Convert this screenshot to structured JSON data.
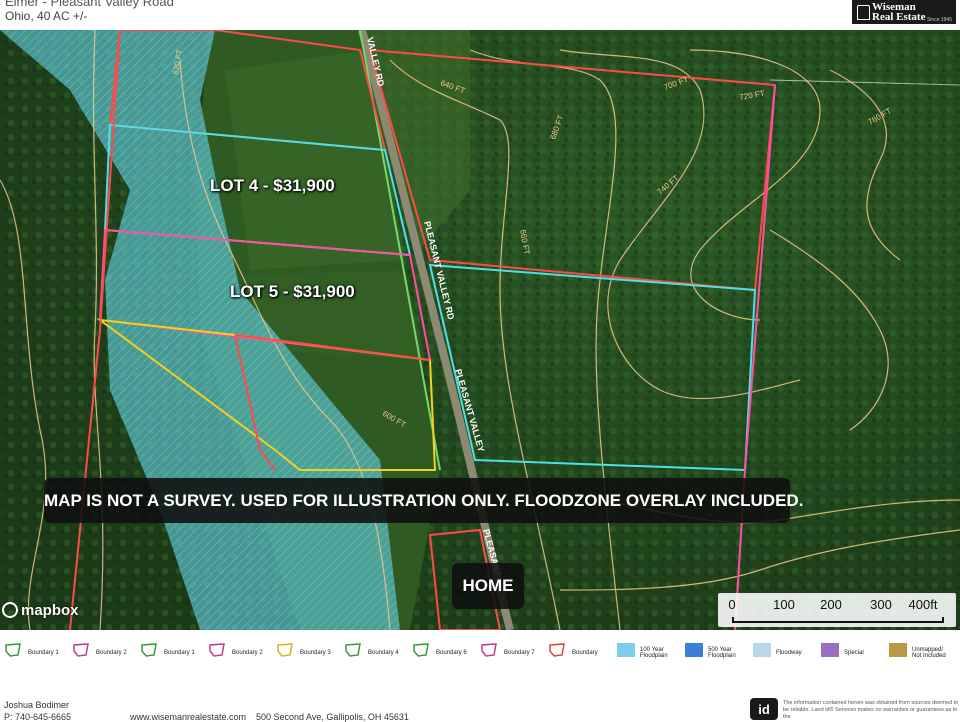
{
  "header": {
    "title": "Elmer - Pleasant Valley Road",
    "subtitle": "Ohio, 40 AC +/-",
    "logo_name_line1": "Wiseman",
    "logo_name_line2": "Real Estate",
    "logo_since": "Since 1945"
  },
  "map": {
    "road_labels": [
      "VALLEY RD",
      "PLEASANT VALLEY RD",
      "PLEASANT VALLEY",
      "PLEASANT"
    ],
    "contour_labels": [
      "600 FT",
      "620 FT",
      "640 FT",
      "660 FT",
      "680 FT",
      "700 FT",
      "720 FT",
      "740 FT",
      "760 FT"
    ],
    "lots": [
      {
        "label": "LOT 4 - $31,900"
      },
      {
        "label": "LOT 5 - $31,900"
      }
    ],
    "disclaimer": "MAP IS NOT A SURVEY. USED FOR ILLUSTRATION ONLY. FLOODZONE OVERLAY INCLUDED.",
    "home_button": "HOME",
    "attribution": "mapbox",
    "scale": {
      "ticks": [
        "0",
        "100",
        "200",
        "300",
        "400ft"
      ]
    },
    "colors": {
      "boundary_red": "#ff4a4a",
      "boundary_pink": "#ff4fa3",
      "boundary_cyan": "#4fe0e6",
      "boundary_yellow": "#f1d21c",
      "boundary_green": "#74d96b",
      "floodplain": "#5cc8d6",
      "contour": "#f0c98e"
    }
  },
  "legend": [
    {
      "label": "Boundary 1",
      "color": "#3a9a3a",
      "shape": "outline"
    },
    {
      "label": "Boundary 2",
      "color": "#c2389a",
      "shape": "outline"
    },
    {
      "label": "Boundary 1",
      "color": "#3a9a3a",
      "shape": "outline"
    },
    {
      "label": "Boundary 2",
      "color": "#c2389a",
      "shape": "outline"
    },
    {
      "label": "Boundary 3",
      "color": "#d4b51a",
      "shape": "outline"
    },
    {
      "label": "Boundary 4",
      "color": "#3a9a3a",
      "shape": "outline"
    },
    {
      "label": "Boundary 6",
      "color": "#3a9a3a",
      "shape": "outline"
    },
    {
      "label": "Boundary 7",
      "color": "#c2389a",
      "shape": "outline"
    },
    {
      "label": "Boundary",
      "color": "#e0433a",
      "shape": "outline"
    },
    {
      "label": "100 Year\nFloodplain",
      "color": "#7fcde8",
      "shape": "fill"
    },
    {
      "label": "500 Year\nFloodplain",
      "color": "#3a7fd4",
      "shape": "fill"
    },
    {
      "label": "Floodway",
      "color": "#9ac7e0",
      "shape": "hatch"
    },
    {
      "label": "Special",
      "color": "#9a6fc0",
      "shape": "fill"
    },
    {
      "label": "Unmapped/\nNot Included",
      "color": "#b89a45",
      "shape": "fill"
    }
  ],
  "footer": {
    "agent_name": "Joshua Bodimer",
    "agent_phone": "P: 740-645-6665",
    "website": "www.wisemanrealestate.com",
    "address": "500 Second Ave, Gallipolis, OH 45631",
    "id_logo": "id",
    "notice": "The information contained herein was obtained from sources deemed to be reliable. Land id® Services makes no warranties or guarantees as to the"
  }
}
